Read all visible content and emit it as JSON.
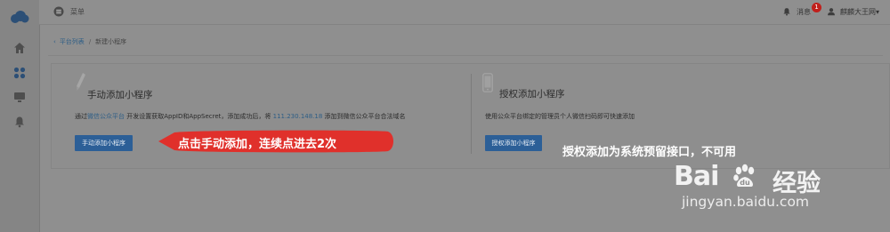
{
  "topbar": {
    "menu_label": "菜单",
    "messages_label": "消息",
    "messages_badge": "1",
    "user_name": "麒麟大王网▾"
  },
  "breadcrumb": {
    "back_link": "平台列表",
    "separator": "/",
    "current": "新建小程序"
  },
  "manual": {
    "title": "手动添加小程序",
    "desc_pre": "通过",
    "desc_link": "微信公众平台",
    "desc_mid": " 开发设置获取AppID和AppSecret，添加成功后，将 ",
    "desc_ip": "111.230.148.18",
    "desc_post": " 添加到微信公众平台合法域名",
    "button": "手动添加小程序"
  },
  "auth": {
    "title": "授权添加小程序",
    "desc": "使用公众平台绑定的管理员个人微信扫码即可快速添加",
    "button": "授权添加小程序"
  },
  "annotations": {
    "callout": "点击手动添加，连续点进去2次",
    "note": "授权添加为系统预留接口，不可用"
  },
  "watermark": {
    "logo": "Bai",
    "logo_cn": "经验",
    "url": "jingyan.baidu.com"
  },
  "colors": {
    "accent": "#2c5f97",
    "callout": "#e0302b"
  },
  "icons": [
    "cloud-logo-icon",
    "home-icon",
    "apps-icon",
    "monitor-icon",
    "bell-icon",
    "menu-icon",
    "user-icon",
    "pencil-icon",
    "phone-icon"
  ]
}
